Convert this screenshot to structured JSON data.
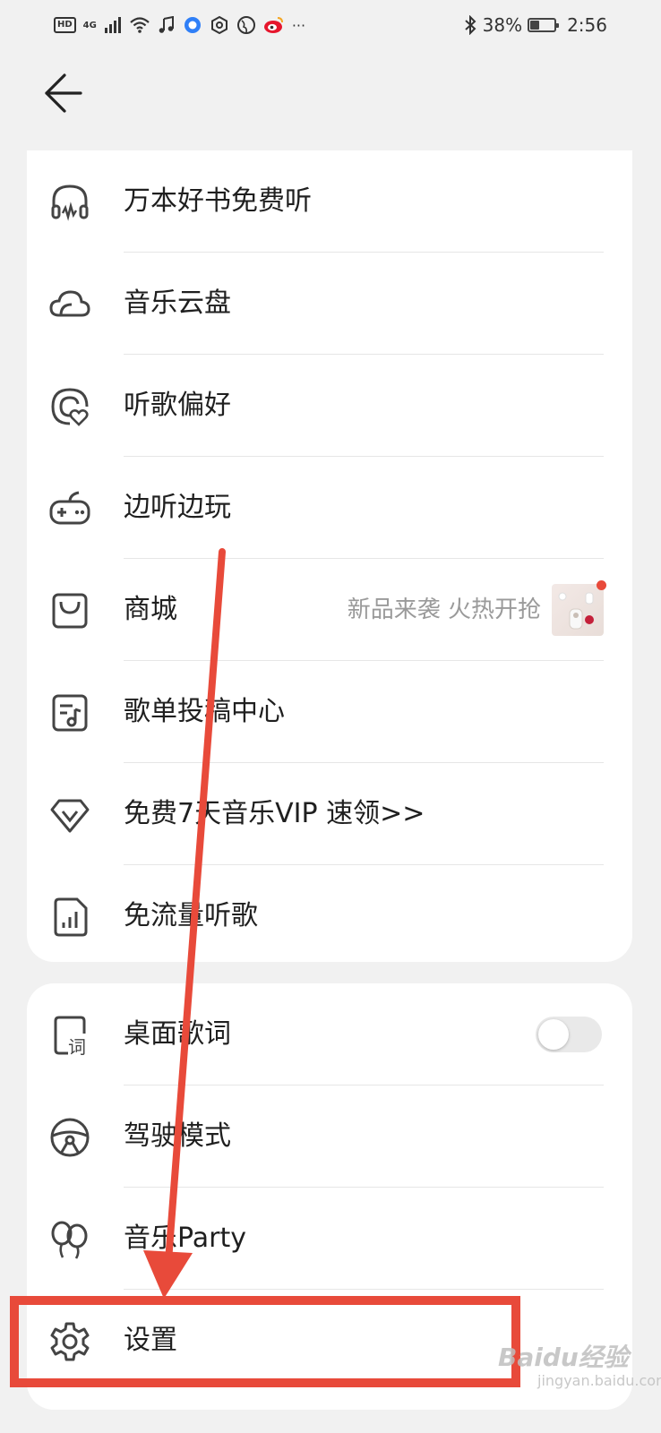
{
  "status_bar": {
    "network": "4G",
    "hd": "HD",
    "more": "···",
    "battery_text": "38%",
    "battery_level": 0.38,
    "time": "2:56"
  },
  "menu_group_1": [
    {
      "label": "万本好书免费听",
      "icon": "headphones-icon"
    },
    {
      "label": "音乐云盘",
      "icon": "cloud-icon"
    },
    {
      "label": "听歌偏好",
      "icon": "preference-heart-icon"
    },
    {
      "label": "边听边玩",
      "icon": "gamepad-icon"
    },
    {
      "label": "商城",
      "icon": "shopping-bag-icon",
      "promo": "新品来袭 火热开抢"
    },
    {
      "label": "歌单投稿中心",
      "icon": "playlist-submit-icon"
    },
    {
      "label": "免费7天音乐VIP  速领>>",
      "icon": "diamond-vip-icon"
    },
    {
      "label": "免流量听歌",
      "icon": "sim-data-icon"
    }
  ],
  "menu_group_2": [
    {
      "label": "桌面歌词",
      "icon": "desktop-lyrics-icon",
      "toggle_on": false
    },
    {
      "label": "驾驶模式",
      "icon": "steering-wheel-icon"
    },
    {
      "label": "音乐Party",
      "icon": "balloons-icon"
    },
    {
      "label": "设置",
      "icon": "gear-icon"
    }
  ],
  "annotation": {
    "arrow_color": "#e84a3a",
    "highlight_color": "#e84a3a"
  },
  "watermark": {
    "text": "Baidu经验",
    "sub": "jingyan.baidu.com"
  }
}
